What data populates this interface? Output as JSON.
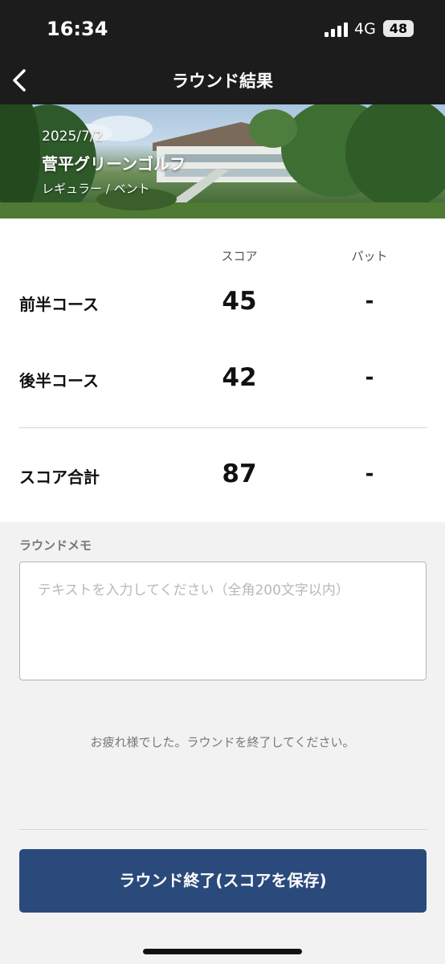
{
  "status_bar": {
    "time": "16:34",
    "network": "4G",
    "battery": "48"
  },
  "nav": {
    "title": "ラウンド結果",
    "back_icon": "chevron-left-icon"
  },
  "round": {
    "date": "2025/7/2",
    "course_name": "菅平グリーンゴルフ",
    "tee": "レギュラー / ベント"
  },
  "score_table": {
    "columns": [
      "スコア",
      "パット"
    ],
    "rows": [
      {
        "label": "前半コース",
        "score": "45",
        "putt": "-"
      },
      {
        "label": "後半コース",
        "score": "42",
        "putt": "-"
      }
    ],
    "total": {
      "label": "スコア合計",
      "score": "87",
      "putt": "-"
    }
  },
  "memo": {
    "label": "ラウンドメモ",
    "placeholder": "テキストを入力してください（全角200文字以内）",
    "value": ""
  },
  "message": "お疲れ様でした。ラウンドを終了してください。",
  "finish_button": {
    "label": "ラウンド終了(スコアを保存)",
    "color": "#2b4a7c"
  },
  "colors": {
    "header_bg": "#1c1c1c",
    "accent": "#2b4a7c"
  }
}
